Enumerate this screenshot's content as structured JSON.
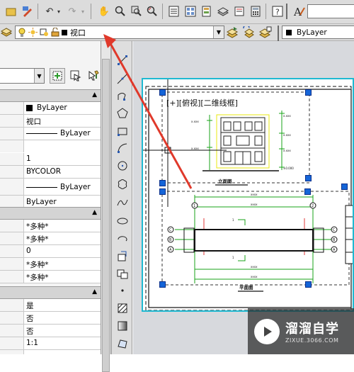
{
  "toolbar": {
    "layer_combo_value": "视口",
    "color_combo_value": "ByLayer"
  },
  "properties": {
    "sections": [
      {
        "rows": [
          "ByLayer",
          "视口",
          "ByLayer",
          "1",
          "BYCOLOR",
          "ByLayer",
          "ByLayer",
          ""
        ]
      },
      {
        "rows": [
          "*多种*",
          "*多种*",
          "0",
          "*多种*",
          "*多种*"
        ]
      },
      {
        "rows": [
          "是",
          "否",
          "否",
          "1:1",
          ""
        ]
      }
    ]
  },
  "viewport": {
    "label": "[+][俯视][二维线框]",
    "drawing_title_1": "立面图",
    "drawing_title_2": "平面图"
  },
  "watermark": {
    "brand": "溜溜自学",
    "url": "ZIXUE.3066.COM"
  },
  "colors": {
    "accent_arrow": "#e0392b",
    "viewport_border": "#1fb9d1",
    "grip": "#1565d8"
  }
}
